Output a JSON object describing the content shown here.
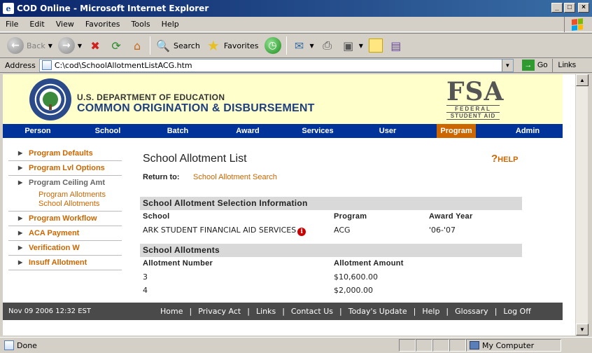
{
  "window": {
    "title": "COD Online - Microsoft Internet Explorer"
  },
  "menubar": {
    "items": [
      "File",
      "Edit",
      "View",
      "Favorites",
      "Tools",
      "Help"
    ]
  },
  "toolbar": {
    "back_label": "Back",
    "search_label": "Search",
    "favorites_label": "Favorites"
  },
  "address": {
    "label": "Address",
    "url": "C:\\cod\\SchoolAllotmentListACG.htm",
    "go_label": "Go",
    "links_label": "Links"
  },
  "banner": {
    "dept_line1": "U.S. DEPARTMENT OF EDUCATION",
    "dept_line2": "COMMON ORIGINATION & DISBURSEMENT",
    "fsa_big": "FSA",
    "fsa_sub1": "FEDERAL",
    "fsa_sub2": "STUDENT AID"
  },
  "nav": {
    "items": [
      "Person",
      "School",
      "Batch",
      "Award",
      "Services",
      "User",
      "Program",
      "Admin"
    ],
    "active": "Program"
  },
  "leftmenu": {
    "items": [
      "Program Defaults",
      "Program Lvl Options",
      "Program Ceiling Amt",
      "Program Workflow",
      "ACA Payment",
      "Verification W",
      "Insuff Allotment"
    ],
    "subitems": [
      "Program Allotments",
      "School Allotments"
    ]
  },
  "main": {
    "title": "School Allotment List",
    "help_label": "HELP",
    "help_q": "?",
    "return_label": "Return to:",
    "return_link": "School Allotment Search",
    "selection": {
      "header": "School Allotment Selection Information",
      "col_school": "School",
      "col_program": "Program",
      "col_award_year": "Award Year",
      "school": "ARK STUDENT FINANCIAL AID SERVICES",
      "program": "ACG",
      "award_year": "'06-'07"
    },
    "allotments": {
      "header": "School Allotments",
      "col_number": "Allotment Number",
      "col_amount": "Allotment Amount",
      "rows": [
        {
          "number": "3",
          "amount": "$10,600.00"
        },
        {
          "number": "4",
          "amount": "$2,000.00"
        }
      ]
    }
  },
  "footer": {
    "date": "Nov 09 2006 12:32 EST",
    "links": [
      "Home",
      "Privacy Act",
      "Links",
      "Contact Us",
      "Today's Update",
      "Help",
      "Glossary",
      "Log Off"
    ]
  },
  "status": {
    "text": "Done",
    "zone": "My Computer"
  },
  "colors": {
    "nav_bg": "#003399",
    "active": "#cc6600",
    "link": "#cc6600",
    "banner": "#ffffcc"
  }
}
